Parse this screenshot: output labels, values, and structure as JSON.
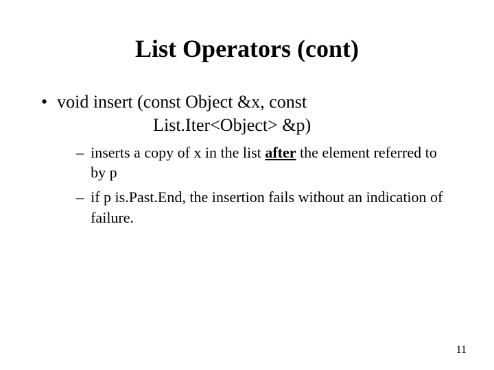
{
  "title": "List Operators (cont)",
  "bullet": {
    "signature_line1": "void insert (const Object &x, const",
    "signature_line2": "List.Iter<Object> &p)"
  },
  "sub": {
    "item1_pre": "inserts a copy of x in the list ",
    "item1_emph": "after",
    "item1_post": " the element referred to by p",
    "item2": "if p is.Past.End, the insertion fails without an indication of failure."
  },
  "page_number": "11"
}
